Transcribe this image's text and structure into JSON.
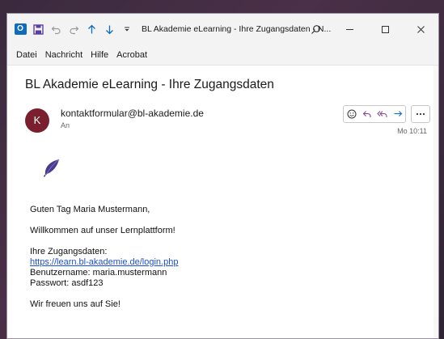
{
  "window": {
    "title": "BL Akademie eLearning - Ihre Zugangsdaten  -  N...",
    "app_icon": "outlook-icon",
    "quick_access": [
      "save-icon",
      "undo-icon",
      "redo-icon",
      "up-arrow-icon",
      "down-arrow-icon",
      "customize-icon"
    ],
    "controls": [
      "search-icon",
      "minimize-icon",
      "maximize-icon",
      "close-icon"
    ]
  },
  "menu": [
    "Datei",
    "Nachricht",
    "Hilfe",
    "Acrobat"
  ],
  "email": {
    "subject": "BL Akademie eLearning - Ihre Zugangsdaten",
    "avatar_letter": "K",
    "avatar_color": "#7a1f2e",
    "sender": "kontaktformular@bl-akademie.de",
    "to_label": "An",
    "time": "Mo 10:11",
    "actions": [
      "emoji-icon",
      "reply-icon",
      "reply-all-icon",
      "forward-icon",
      "more-icon"
    ],
    "body": {
      "greeting": "Guten Tag Maria Mustermann,",
      "welcome": "Willkommen auf unser Lernplattform!",
      "credentials_label": "Ihre Zugangsdaten:",
      "link": "https://learn.bl-akademie.de/login.php",
      "username_line": "Benutzername: maria.mustermann",
      "password_line": "Passwort: asdf123",
      "closing": "Wir freuen uns auf Sie!"
    }
  },
  "colors": {
    "accent": "#0f6cbd",
    "link": "#1a4fd6",
    "feather": "#4a3a8c"
  }
}
